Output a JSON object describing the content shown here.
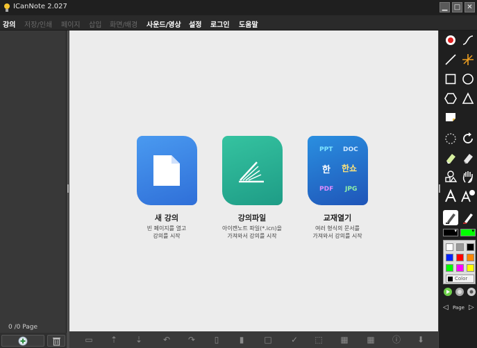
{
  "window": {
    "title": "ICanNote 2.027",
    "minimize": "▁",
    "maximize": "□",
    "close": "✕"
  },
  "menu": [
    {
      "label": "강의",
      "enabled": true
    },
    {
      "label": "저장/인쇄",
      "enabled": false
    },
    {
      "label": "페이지",
      "enabled": false
    },
    {
      "label": "삽입",
      "enabled": false
    },
    {
      "label": "화면/배경",
      "enabled": false
    },
    {
      "label": "사운드/영상",
      "enabled": true
    },
    {
      "label": "설정",
      "enabled": true
    },
    {
      "label": "로그인",
      "enabled": true
    },
    {
      "label": "도움말",
      "enabled": true
    }
  ],
  "left": {
    "page_count": "0  /0 Page"
  },
  "cards": [
    {
      "title": "새 강의",
      "desc1": "빈 페이지를 열고",
      "desc2": "강의를 시작",
      "color_top": "#4a9af0",
      "color_bottom": "#2f6fd8"
    },
    {
      "title": "강의파일",
      "desc1": "아이캔노트 파일(*.icn)을",
      "desc2": "가져와서 강의를 시작",
      "color_top": "#35c3a0",
      "color_bottom": "#1e9c86"
    },
    {
      "title": "교재열기",
      "desc1": "여러 형식의 문서를",
      "desc2": "가져와서 강의를 시작",
      "color_top": "#2a8fe0",
      "color_bottom": "#1f55b8"
    }
  ],
  "formats": {
    "ppt": "PPT",
    "doc": "DOC",
    "hwp": "한",
    "show": "한쇼",
    "pdf": "PDF",
    "jpg": "JPG"
  },
  "palette": {
    "colors": [
      "#ffffff",
      "#9a9a9a",
      "#000000",
      "#0022ff",
      "#ff0000",
      "#ff8800",
      "#00ff00",
      "#ff00ff",
      "#ffff00"
    ],
    "current_pen": "#000000",
    "current_fill": "#00ff00",
    "color_label": "Color"
  },
  "nav": {
    "page_label": "Page"
  }
}
